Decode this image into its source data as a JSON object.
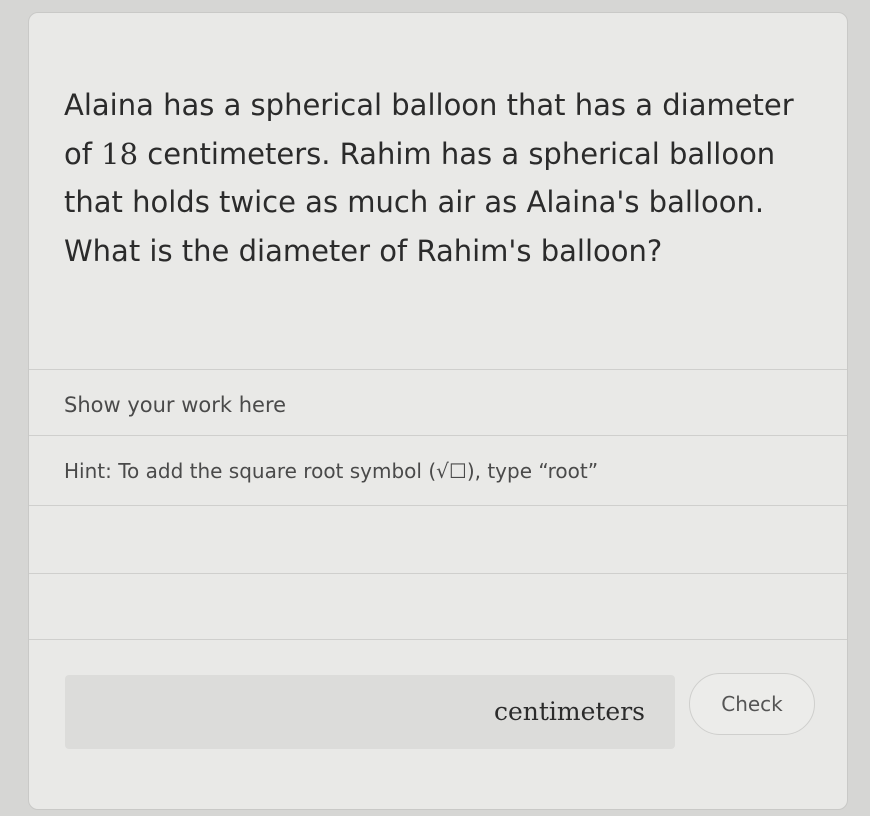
{
  "question": {
    "part1": "Alaina has a spherical balloon that has a diameter of ",
    "number": "18",
    "part2": " centimeters. Rahim has a spherical balloon that holds twice as much air as Alaina's balloon. What is the diameter of Rahim's balloon?"
  },
  "work_area": {
    "label": "Show your work here",
    "hint": "Hint: To add the square root symbol (√☐), type “root”"
  },
  "answer": {
    "unit": "centimeters"
  },
  "check_button": {
    "label": "Check"
  }
}
